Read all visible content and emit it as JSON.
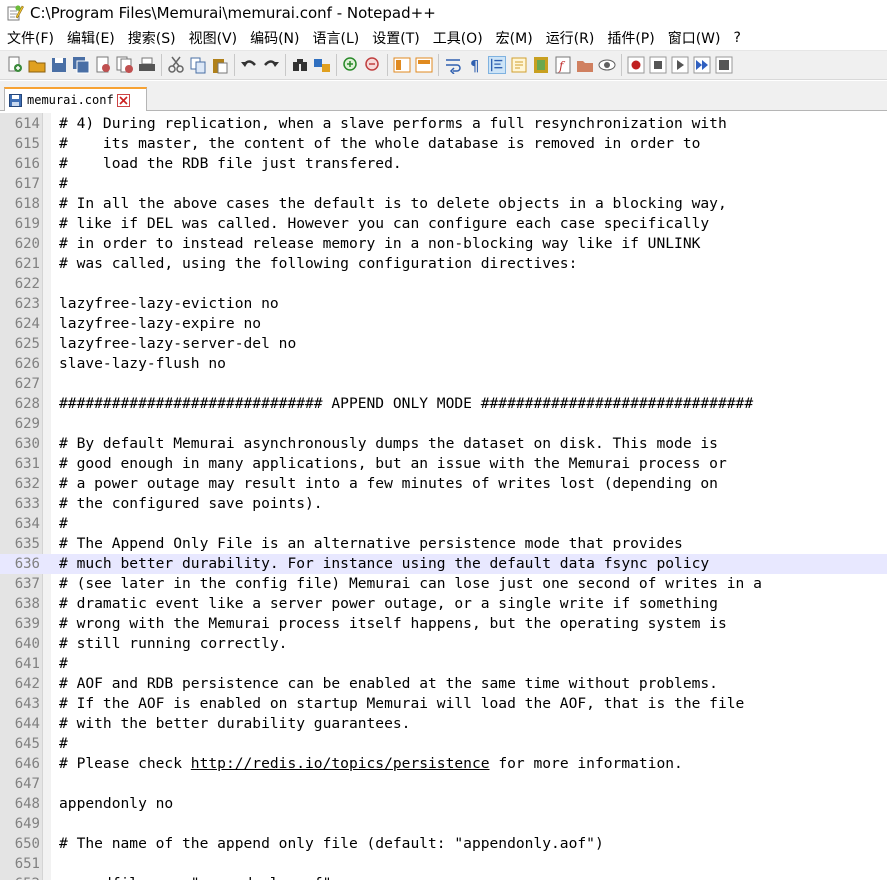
{
  "window": {
    "title": "C:\\Program Files\\Memurai\\memurai.conf - Notepad++",
    "icon": "notepad-plus-plus-icon"
  },
  "menu": [
    "文件(F)",
    "编辑(E)",
    "搜索(S)",
    "视图(V)",
    "编码(N)",
    "语言(L)",
    "设置(T)",
    "工具(O)",
    "宏(M)",
    "运行(R)",
    "插件(P)",
    "窗口(W)",
    "?"
  ],
  "tab": {
    "label": "memurai.conf"
  },
  "editor": {
    "current_line": "636",
    "lines": [
      {
        "n": "614",
        "t": "# 4) During replication, when a slave performs a full resynchronization with"
      },
      {
        "n": "615",
        "t": "#    its master, the content of the whole database is removed in order to"
      },
      {
        "n": "616",
        "t": "#    load the RDB file just transfered."
      },
      {
        "n": "617",
        "t": "#"
      },
      {
        "n": "618",
        "t": "# In all the above cases the default is to delete objects in a blocking way,"
      },
      {
        "n": "619",
        "t": "# like if DEL was called. However you can configure each case specifically"
      },
      {
        "n": "620",
        "t": "# in order to instead release memory in a non-blocking way like if UNLINK"
      },
      {
        "n": "621",
        "t": "# was called, using the following configuration directives:"
      },
      {
        "n": "622",
        "t": ""
      },
      {
        "n": "623",
        "t": "lazyfree-lazy-eviction no"
      },
      {
        "n": "624",
        "t": "lazyfree-lazy-expire no"
      },
      {
        "n": "625",
        "t": "lazyfree-lazy-server-del no"
      },
      {
        "n": "626",
        "t": "slave-lazy-flush no"
      },
      {
        "n": "627",
        "t": ""
      },
      {
        "n": "628",
        "t": "############################## APPEND ONLY MODE ###############################"
      },
      {
        "n": "629",
        "t": ""
      },
      {
        "n": "630",
        "t": "# By default Memurai asynchronously dumps the dataset on disk. This mode is"
      },
      {
        "n": "631",
        "t": "# good enough in many applications, but an issue with the Memurai process or"
      },
      {
        "n": "632",
        "t": "# a power outage may result into a few minutes of writes lost (depending on"
      },
      {
        "n": "633",
        "t": "# the configured save points)."
      },
      {
        "n": "634",
        "t": "#"
      },
      {
        "n": "635",
        "t": "# The Append Only File is an alternative persistence mode that provides"
      },
      {
        "n": "636",
        "t": "# much better durability. For instance using the default data fsync policy"
      },
      {
        "n": "637",
        "t": "# (see later in the config file) Memurai can lose just one second of writes in a"
      },
      {
        "n": "638",
        "t": "# dramatic event like a server power outage, or a single write if something"
      },
      {
        "n": "639",
        "t": "# wrong with the Memurai process itself happens, but the operating system is"
      },
      {
        "n": "640",
        "t": "# still running correctly."
      },
      {
        "n": "641",
        "t": "#"
      },
      {
        "n": "642",
        "t": "# AOF and RDB persistence can be enabled at the same time without problems."
      },
      {
        "n": "643",
        "t": "# If the AOF is enabled on startup Memurai will load the AOF, that is the file"
      },
      {
        "n": "644",
        "t": "# with the better durability guarantees."
      },
      {
        "n": "645",
        "t": "#"
      },
      {
        "n": "646",
        "t": "# Please check ",
        "link": "http://redis.io/topics/persistence",
        "after": " for more information."
      },
      {
        "n": "647",
        "t": ""
      },
      {
        "n": "648",
        "t": "appendonly no"
      },
      {
        "n": "649",
        "t": ""
      },
      {
        "n": "650",
        "t": "# The name of the append only file (default: \"appendonly.aof\")"
      },
      {
        "n": "651",
        "t": ""
      },
      {
        "n": "652",
        "t": "appendfilename \"appendonly.aof\""
      }
    ]
  },
  "toolbar": [
    {
      "icon": "new-file-icon",
      "color": "#3a8a3a"
    },
    {
      "icon": "open-file-icon",
      "color": "#e0a020"
    },
    {
      "icon": "save-icon",
      "color": "#4a6fa5"
    },
    {
      "icon": "save-all-icon",
      "color": "#4a6fa5"
    },
    {
      "icon": "close-file-icon",
      "color": "#c05050"
    },
    {
      "icon": "close-all-icon",
      "color": "#c05050"
    },
    {
      "icon": "print-icon",
      "color": "#555555"
    },
    {
      "sep": true
    },
    {
      "icon": "cut-icon",
      "color": "#666666"
    },
    {
      "icon": "copy-icon",
      "color": "#4a6fa5"
    },
    {
      "icon": "paste-icon",
      "color": "#b0801a"
    },
    {
      "sep": true
    },
    {
      "icon": "undo-icon",
      "color": "#333333"
    },
    {
      "icon": "redo-icon",
      "color": "#333333"
    },
    {
      "sep": true
    },
    {
      "icon": "find-icon",
      "color": "#333333"
    },
    {
      "icon": "replace-icon",
      "color": "#3070c0"
    },
    {
      "sep": true
    },
    {
      "icon": "zoom-in-icon",
      "color": "#2a8a2a"
    },
    {
      "icon": "zoom-out-icon",
      "color": "#c04040"
    },
    {
      "sep": true
    },
    {
      "icon": "sync-vertical-icon",
      "color": "#e08a20"
    },
    {
      "icon": "sync-horizontal-icon",
      "color": "#e08a20"
    },
    {
      "sep": true
    },
    {
      "icon": "word-wrap-icon",
      "color": "#3060b0"
    },
    {
      "icon": "show-all-chars-icon",
      "color": "#3060b0"
    },
    {
      "icon": "indent-guide-icon",
      "color": "#3060b0",
      "active": true
    },
    {
      "icon": "language-icon",
      "color": "#d0a030"
    },
    {
      "icon": "document-map-icon",
      "color": "#c8a020"
    },
    {
      "icon": "function-list-icon",
      "color": "#c03030"
    },
    {
      "icon": "folder-workspace-icon",
      "color": "#d08060"
    },
    {
      "icon": "monitoring-icon",
      "color": "#606060"
    },
    {
      "sep": true
    },
    {
      "icon": "record-macro-icon",
      "color": "#c02020"
    },
    {
      "icon": "stop-macro-icon",
      "color": "#555555"
    },
    {
      "icon": "play-macro-icon",
      "color": "#555555"
    },
    {
      "icon": "run-macro-multiple-icon",
      "color": "#3060c0"
    },
    {
      "icon": "save-macro-icon",
      "color": "#555555"
    }
  ]
}
